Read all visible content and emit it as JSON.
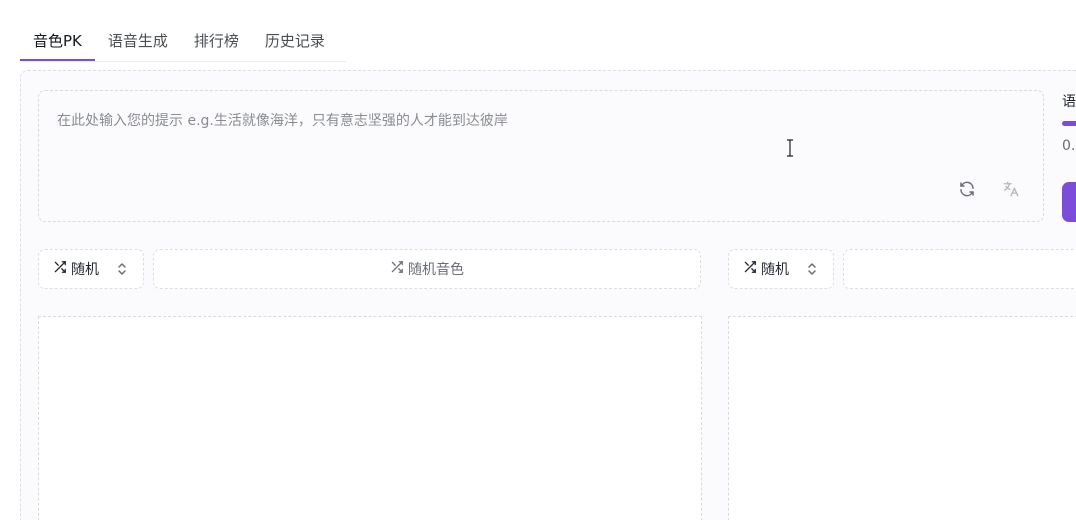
{
  "tabs": [
    {
      "label": "音色PK",
      "active": true
    },
    {
      "label": "语音生成"
    },
    {
      "label": "排行榜"
    },
    {
      "label": "历史记录"
    }
  ],
  "prompt": {
    "placeholder": "在此处输入您的提示 e.g.生活就像海洋，只有意志坚强的人才能到达彼岸",
    "value": "",
    "icons": [
      "refresh-icon",
      "translate-icon"
    ]
  },
  "settings": {
    "label_partial": "语",
    "value_partial": "0."
  },
  "left": {
    "select_label": "随机",
    "voice_label": "随机音色"
  },
  "right": {
    "select_label": "随机",
    "voice_label": ""
  },
  "colors": {
    "accent": "#7c4ddb",
    "border": "#dcdde3",
    "panel_bg": "#fbfbfd"
  }
}
